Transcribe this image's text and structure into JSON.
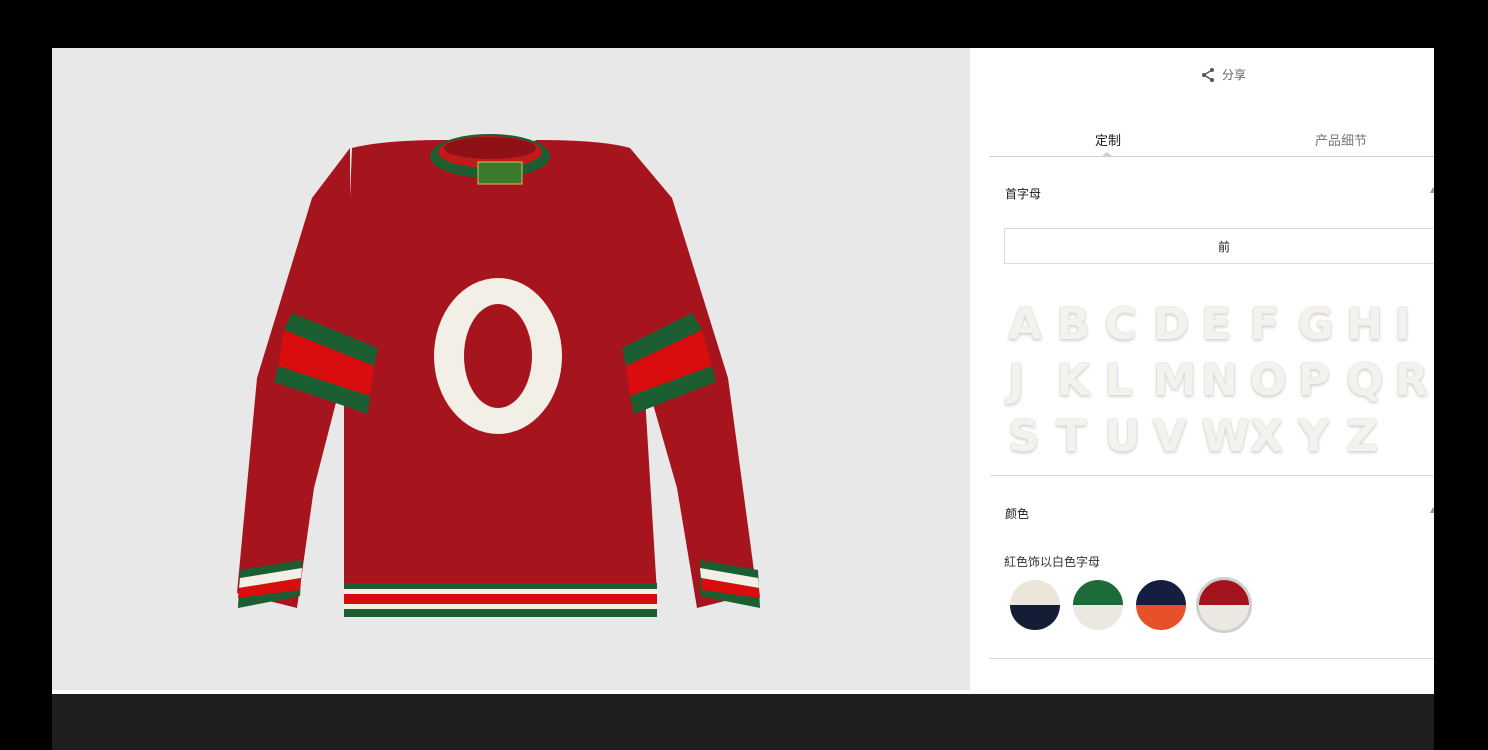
{
  "share": {
    "label": "分享"
  },
  "tabs": [
    {
      "label": "定制"
    },
    {
      "label": "产品细节"
    }
  ],
  "initials_section": {
    "title": "首字母"
  },
  "position": {
    "selected": "前"
  },
  "letters": [
    [
      "A",
      "B",
      "C",
      "D",
      "E",
      "F",
      "G",
      "H",
      "I"
    ],
    [
      "J",
      "K",
      "L",
      "M",
      "N",
      "O",
      "P",
      "Q",
      "R"
    ],
    [
      "S",
      "T",
      "U",
      "V",
      "W",
      "X",
      "Y",
      "Z"
    ]
  ],
  "color_section": {
    "title": "颜色",
    "selected_label": "紅色饰以白色字母"
  },
  "swatches": [
    {
      "top": "#ebe6d9",
      "bottom": "#141c36",
      "selected": false
    },
    {
      "top": "#1e6b3a",
      "bottom": "#ebe8e1",
      "selected": false
    },
    {
      "top": "#151e40",
      "bottom": "#e6512a",
      "selected": false
    },
    {
      "top": "#a3141d",
      "bottom": "#ebe8e1",
      "selected": true
    }
  ],
  "product": {
    "initial": "O"
  },
  "colors": {
    "sweater_red": "#a6151d",
    "stripe_red": "#d90d0d",
    "stripe_green": "#1b5e32",
    "image_bg": "#e8e8e8"
  }
}
